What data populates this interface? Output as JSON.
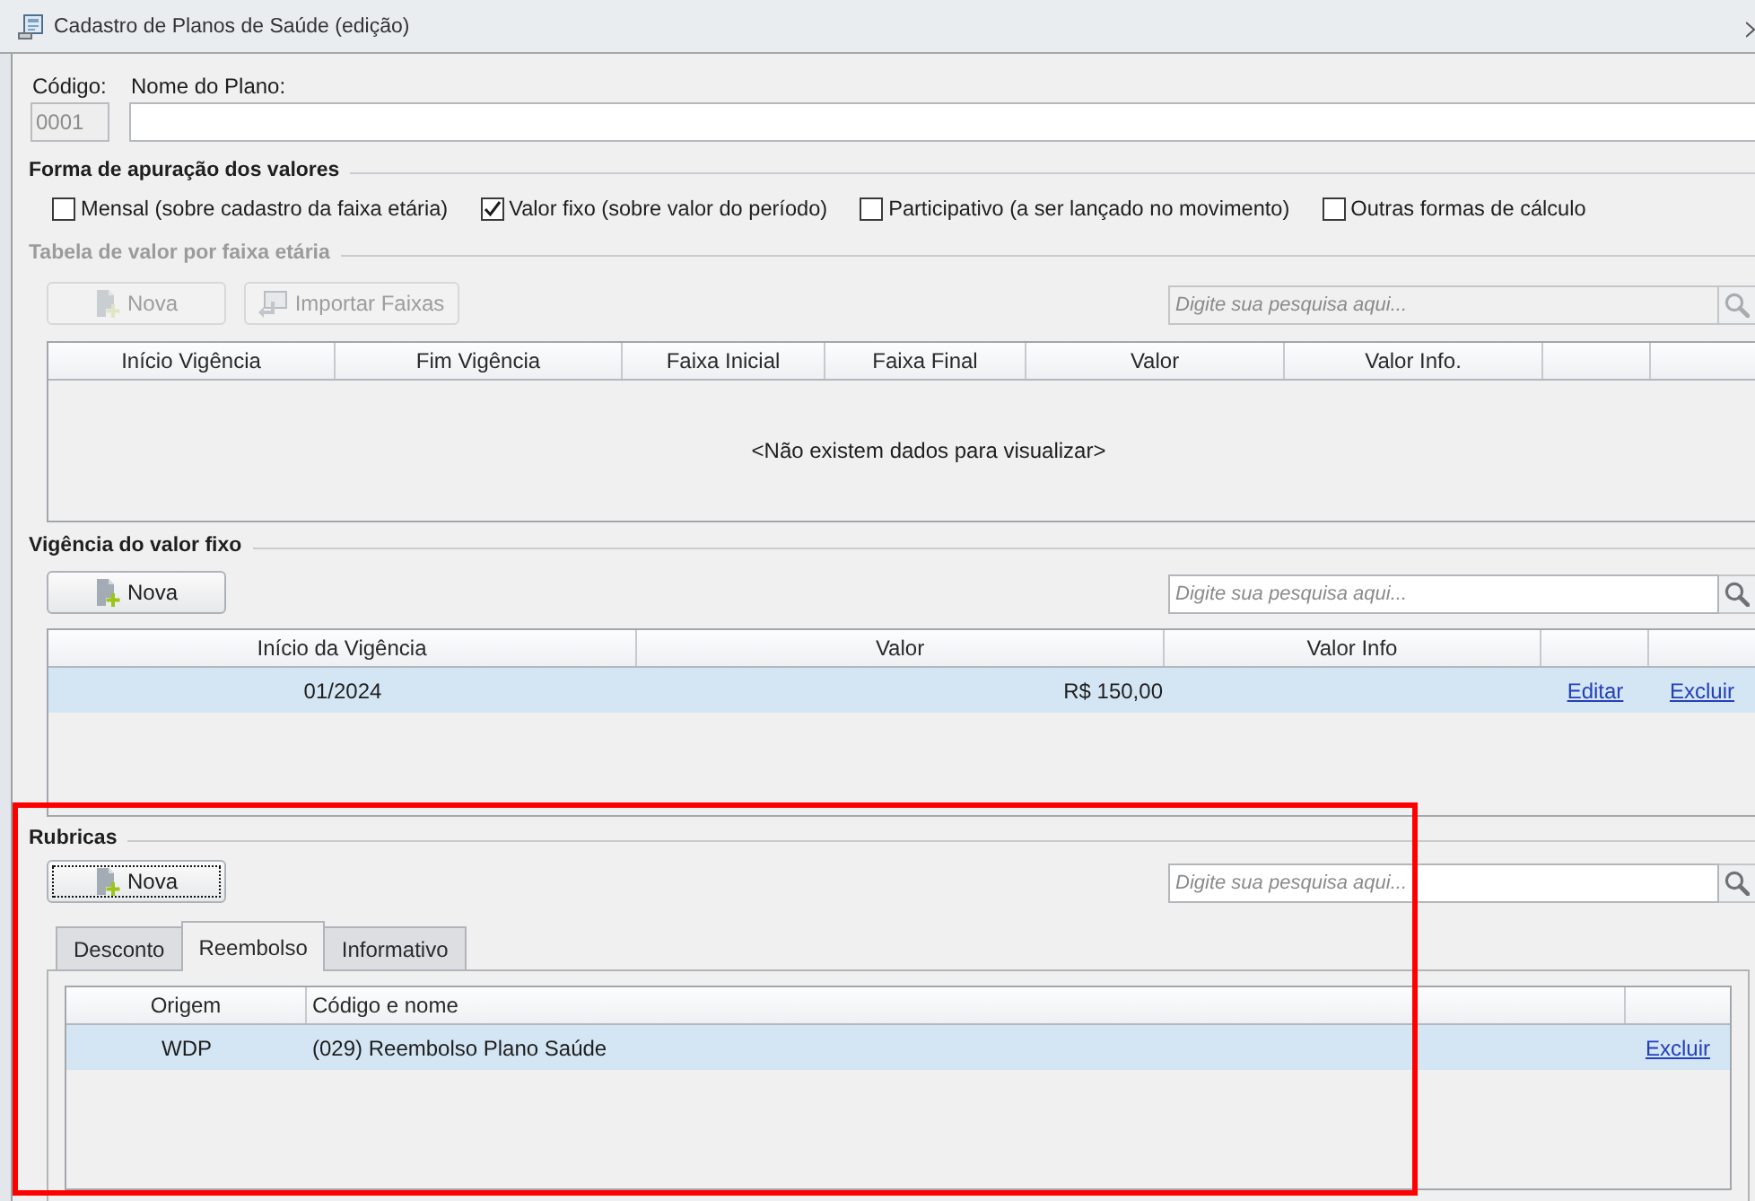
{
  "window": {
    "title": "Cadastro de Planos de Saúde (edição)"
  },
  "fields": [
    {
      "label": "Código:",
      "value": "0001",
      "disabled": true
    },
    {
      "label": "Nome do Plano:",
      "disabled": false
    }
  ],
  "calculation": {
    "title": "Forma de apuração dos valores",
    "options": [
      {
        "label": "Mensal (sobre cadastro da faixa etária)",
        "checked": false
      },
      {
        "label": "Valor fixo (sobre valor do período)",
        "checked": true
      },
      {
        "label": "Participativo (a ser lançado no movimento)",
        "checked": false
      },
      {
        "label": "Outras formas de cálculo",
        "checked": false
      }
    ]
  },
  "panels": [
    {
      "title": "Tabela de valor por faixa etária",
      "disabled": true,
      "highlighted": false,
      "buttons": [
        {
          "label": "Nova",
          "kind": "new",
          "focused": false
        },
        {
          "label": "Importar Faixas",
          "kind": "import",
          "focused": false
        }
      ],
      "search": {
        "placeholder": "Digite sua pesquisa aqui..."
      },
      "table": {
        "columns": [
          {
            "label": "Início Vigência",
            "kind": "text"
          },
          {
            "label": "Fim Vigência",
            "kind": "text"
          },
          {
            "label": "Faixa Inicial",
            "kind": "text"
          },
          {
            "label": "Faixa Final",
            "kind": "text"
          },
          {
            "label": "Valor",
            "kind": "text"
          },
          {
            "label": "Valor Info.",
            "kind": "text"
          },
          {
            "kind": "action"
          },
          {
            "kind": "action"
          }
        ],
        "empty_message": "<Não existem dados para visualizar>"
      }
    },
    {
      "title": "Vigência do valor fixo",
      "disabled": false,
      "highlighted": false,
      "buttons": [
        {
          "label": "Nova",
          "kind": "new",
          "focused": false
        }
      ],
      "search": {
        "placeholder": "Digite sua pesquisa aqui..."
      },
      "table": {
        "columns": [
          {
            "label": "Início da Vigência",
            "kind": "text"
          },
          {
            "label": "Valor",
            "kind": "text"
          },
          {
            "label": "Valor Info",
            "kind": "text"
          },
          {
            "kind": "action"
          },
          {
            "kind": "action"
          }
        ],
        "rows": [
          {
            "cells": [
              "01/2024",
              "R$ 150,00",
              null,
              "Editar",
              "Excluir"
            ],
            "selected": true
          }
        ]
      }
    },
    {
      "title": "Rubricas",
      "disabled": false,
      "highlighted": true,
      "buttons": [
        {
          "label": "Nova",
          "kind": "new",
          "focused": true
        }
      ],
      "search": {
        "placeholder": "Digite sua pesquisa aqui..."
      },
      "tabs": [
        {
          "label": "Desconto",
          "selected": false
        },
        {
          "label": "Reembolso",
          "selected": true
        },
        {
          "label": "Informativo",
          "selected": false
        }
      ],
      "table": {
        "columns": [
          {
            "label": "Origem",
            "kind": "text"
          },
          {
            "label": "Código e nome",
            "kind": "text"
          },
          {
            "kind": "action"
          }
        ],
        "rows": [
          {
            "cells": [
              "WDP",
              "(029) Reembolso Plano Saúde",
              "Excluir"
            ],
            "selected": true
          }
        ]
      }
    }
  ]
}
